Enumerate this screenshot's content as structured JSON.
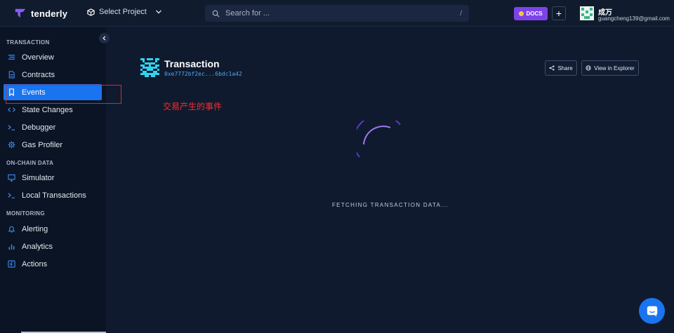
{
  "header": {
    "brand": "tenderly",
    "project_label": "Select Project",
    "search_placeholder": "Search for ...",
    "search_shortcut": "/",
    "docs_label": "DOCS",
    "add_label": "+",
    "user_name": "成万",
    "user_email": "guangcheng139@gmail.com"
  },
  "sidebar": {
    "sections": [
      {
        "label": "TRANSACTION",
        "items": [
          {
            "label": "Overview",
            "icon": "list-icon"
          },
          {
            "label": "Contracts",
            "icon": "document-icon"
          },
          {
            "label": "Events",
            "icon": "bookmark-icon",
            "active": true
          },
          {
            "label": "State Changes",
            "icon": "code-icon"
          },
          {
            "label": "Debugger",
            "icon": "terminal-icon"
          },
          {
            "label": "Gas Profiler",
            "icon": "gear-icon"
          }
        ]
      },
      {
        "label": "ON-CHAIN DATA",
        "items": [
          {
            "label": "Simulator",
            "icon": "monitor-icon"
          },
          {
            "label": "Local Transactions",
            "icon": "terminal-icon"
          }
        ]
      },
      {
        "label": "MONITORING",
        "items": [
          {
            "label": "Alerting",
            "icon": "bell-icon"
          },
          {
            "label": "Analytics",
            "icon": "bar-chart-icon"
          },
          {
            "label": "Actions",
            "icon": "lightning-icon"
          }
        ]
      }
    ]
  },
  "transaction": {
    "title": "Transaction",
    "hash": "0xe7772bf2ec...6bdc1a42",
    "share_label": "Share",
    "explorer_label": "View in Explorer"
  },
  "annotation": "交易产生的事件",
  "loading": "FETCHING TRANSACTION DATA...",
  "colors": {
    "background": "#0f1a2e",
    "sidebar": "#0b1424",
    "accent": "#1a74f0",
    "docs": "#7d43e8",
    "annotation": "#ff2a2a",
    "spinner": "#7b4fe0"
  }
}
